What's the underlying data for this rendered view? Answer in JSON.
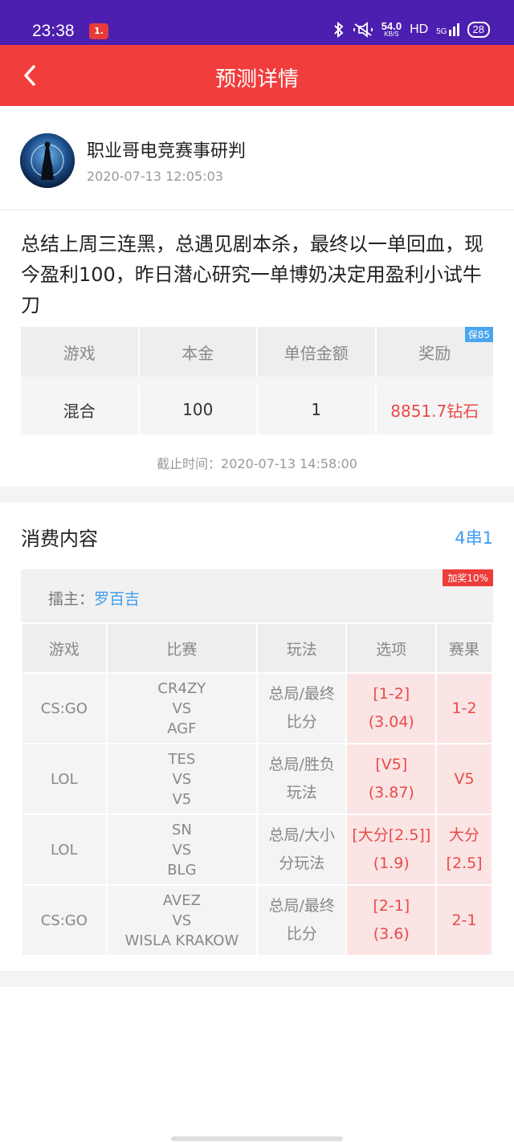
{
  "status_bar": {
    "time": "23:38",
    "notification_badge": "1.",
    "net_speed": "54.0",
    "net_speed_unit": "KB/S",
    "hd": "HD",
    "signal": "5G",
    "battery": "28"
  },
  "header": {
    "title": "预测详情",
    "back_icon": "chevron-left-icon"
  },
  "author": {
    "name": "职业哥电竞赛事研判",
    "date": "2020-07-13 12:05:03"
  },
  "summary": "总结上周三连黑，总遇见剧本杀，最终以一单回血，现今盈利100，昨日潜心研究一单博奶决定用盈利小试牛刀",
  "bet_table": {
    "headers": [
      "游戏",
      "本金",
      "单倍金额",
      "奖励"
    ],
    "values": [
      "混合",
      "100",
      "1",
      "8851.7钻石"
    ],
    "badge": "保85"
  },
  "deadline": "截止时间：2020-07-13 14:58:00",
  "consumption": {
    "title": "消费内容",
    "type": "4串1",
    "host_label": "擂主：",
    "host_name": "罗百吉",
    "bonus_badge": "加奖10%",
    "columns": [
      "游戏",
      "比赛",
      "玩法",
      "选项",
      "赛果"
    ],
    "rows": [
      {
        "game": "CS:GO",
        "team1": "CR4ZY",
        "vs": "VS",
        "team2": "AGF",
        "play1": "总局/最终",
        "play2": "比分",
        "pick": "[1-2]",
        "odds": "(3.04)",
        "result1": "1-2",
        "result2": ""
      },
      {
        "game": "LOL",
        "team1": "TES",
        "vs": "VS",
        "team2": "V5",
        "play1": "总局/胜负",
        "play2": "玩法",
        "pick": "[V5]",
        "odds": "(3.87)",
        "result1": "V5",
        "result2": ""
      },
      {
        "game": "LOL",
        "team1": "SN",
        "vs": "VS",
        "team2": "BLG",
        "play1": "总局/大小",
        "play2": "分玩法",
        "pick": "[大分[2.5]]",
        "odds": "(1.9)",
        "result1": "大分",
        "result2": "[2.5]"
      },
      {
        "game": "CS:GO",
        "team1": "AVEZ",
        "vs": "VS",
        "team2": "WISLA KRAKOW",
        "play1": "总局/最终",
        "play2": "比分",
        "pick": "[2-1]",
        "odds": "(3.6)",
        "result1": "2-1",
        "result2": ""
      }
    ]
  },
  "colors": {
    "status_bar": "#4c1fb0",
    "header": "#f23d3d",
    "accent_blue": "#3e9bf0",
    "accent_red": "#e84a4a"
  }
}
